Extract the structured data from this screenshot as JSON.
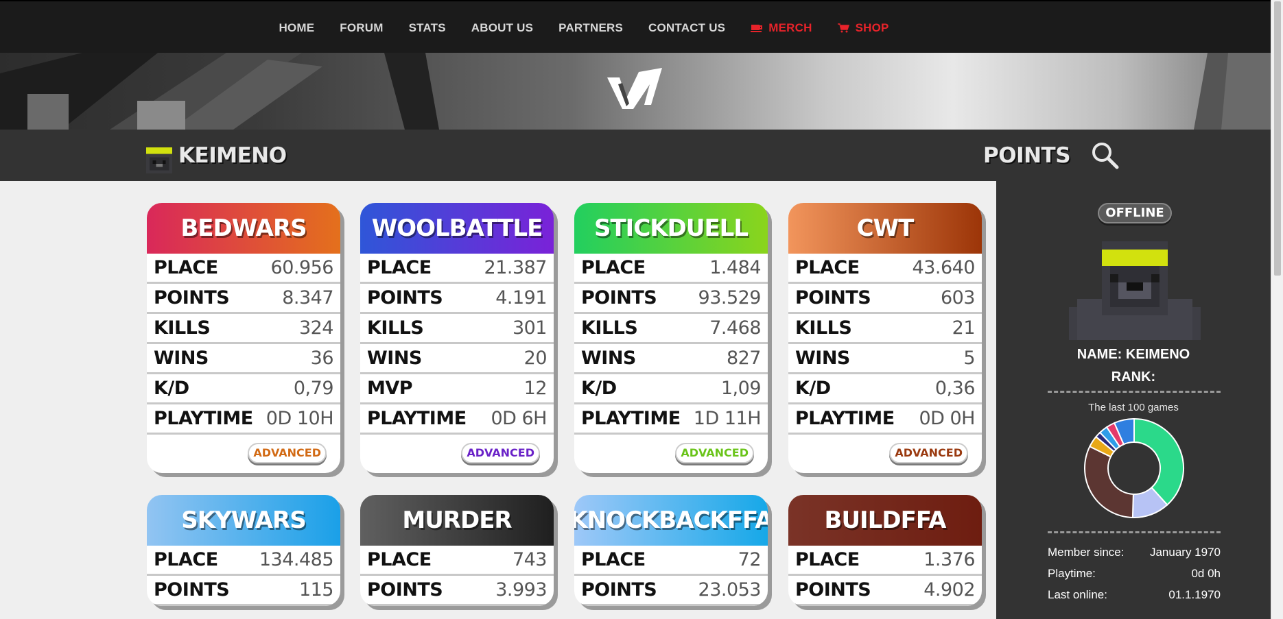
{
  "nav": {
    "items": [
      {
        "label": "HOME",
        "red": false,
        "icon": ""
      },
      {
        "label": "FORUM",
        "red": false,
        "icon": ""
      },
      {
        "label": "STATS",
        "red": false,
        "icon": ""
      },
      {
        "label": "ABOUT US",
        "red": false,
        "icon": ""
      },
      {
        "label": "PARTNERS",
        "red": false,
        "icon": ""
      },
      {
        "label": "CONTACT US",
        "red": false,
        "icon": ""
      },
      {
        "label": "MERCH",
        "red": true,
        "icon": "coffee-cup-icon"
      },
      {
        "label": "SHOP",
        "red": true,
        "icon": "shopping-cart-icon"
      }
    ]
  },
  "banner": {
    "logo_icon": "vn-logo"
  },
  "player": {
    "name": "KEIMENO",
    "points_label": "POINTS",
    "search_icon": "search-icon"
  },
  "cards": [
    {
      "title": "BEDWARS",
      "gradient": [
        "#d9285a",
        "#e4701c"
      ],
      "accent": "#d26a14",
      "rows": [
        [
          "PLACE",
          "60.956"
        ],
        [
          "POINTS",
          "8.347"
        ],
        [
          "KILLS",
          "324"
        ],
        [
          "WINS",
          "36"
        ],
        [
          "K/D",
          "0,79"
        ],
        [
          "PLAYTIME",
          "0D 10H"
        ]
      ],
      "button": "ADVANCED"
    },
    {
      "title": "WOOLBATTLE",
      "gradient": [
        "#2f56d8",
        "#7a22d8"
      ],
      "accent": "#6a22c8",
      "rows": [
        [
          "PLACE",
          "21.387"
        ],
        [
          "POINTS",
          "4.191"
        ],
        [
          "KILLS",
          "301"
        ],
        [
          "WINS",
          "20"
        ],
        [
          "MVP",
          "12"
        ],
        [
          "PLAYTIME",
          "0D 6H"
        ]
      ],
      "button": "ADVANCED"
    },
    {
      "title": "STICKDUELL",
      "gradient": [
        "#22cf5f",
        "#8bd41c"
      ],
      "accent": "#6ac41a",
      "rows": [
        [
          "PLACE",
          "1.484"
        ],
        [
          "POINTS",
          "93.529"
        ],
        [
          "KILLS",
          "7.468"
        ],
        [
          "WINS",
          "827"
        ],
        [
          "K/D",
          "1,09"
        ],
        [
          "PLAYTIME",
          "1D 11H"
        ]
      ],
      "button": "ADVANCED"
    },
    {
      "title": "CWT",
      "gradient": [
        "#f2955c",
        "#9c3508"
      ],
      "accent": "#9a3a10",
      "rows": [
        [
          "PLACE",
          "43.640"
        ],
        [
          "POINTS",
          "603"
        ],
        [
          "KILLS",
          "21"
        ],
        [
          "WINS",
          "5"
        ],
        [
          "K/D",
          "0,36"
        ],
        [
          "PLAYTIME",
          "0D 0H"
        ]
      ],
      "button": "ADVANCED"
    },
    {
      "title": "SKYWARS",
      "gradient": [
        "#92c4f2",
        "#1aa0e8"
      ],
      "accent": "#1a90d8",
      "rows": [
        [
          "PLACE",
          "134.485"
        ],
        [
          "POINTS",
          "115"
        ]
      ],
      "button": ""
    },
    {
      "title": "MURDER",
      "gradient": [
        "#606060",
        "#1f1f1f"
      ],
      "accent": "#333333",
      "rows": [
        [
          "PLACE",
          "743"
        ],
        [
          "POINTS",
          "3.993"
        ]
      ],
      "button": ""
    },
    {
      "title": "KNOCKBACKFFA",
      "gradient": [
        "#9ec8f8",
        "#16a8e8"
      ],
      "accent": "#1a90d8",
      "rows": [
        [
          "PLACE",
          "72"
        ],
        [
          "POINTS",
          "23.053"
        ]
      ],
      "button": ""
    },
    {
      "title": "BUILDFFA",
      "gradient": [
        "#7a3327",
        "#6e1d10"
      ],
      "accent": "#6e1d10",
      "rows": [
        [
          "PLACE",
          "1.376"
        ],
        [
          "POINTS",
          "4.902"
        ]
      ],
      "button": ""
    }
  ],
  "sidebar": {
    "status": "OFFLINE",
    "name_line": "NAME: KEIMENO",
    "rank_line": "RANK:",
    "games_title": "The last 100 games",
    "info": [
      {
        "label": "Member since:",
        "value": "January 1970"
      },
      {
        "label": "Playtime:",
        "value": "0d 0h"
      },
      {
        "label": "Last online:",
        "value": "01.1.1970"
      }
    ]
  },
  "chart_data": {
    "type": "pie",
    "title": "The last 100 games",
    "slices": [
      {
        "value": 41,
        "color": "#2bd98a"
      },
      {
        "value": 13,
        "color": "#b7c3f5"
      },
      {
        "value": 34,
        "color": "#5c3632"
      },
      {
        "value": 4,
        "color": "#e8a817"
      },
      {
        "value": 2,
        "color": "#2a2a7a"
      },
      {
        "value": 3,
        "color": "#2f9de8"
      },
      {
        "value": 3,
        "color": "#e43a6a"
      },
      {
        "value": 7,
        "color": "#2f7fe0"
      }
    ]
  }
}
